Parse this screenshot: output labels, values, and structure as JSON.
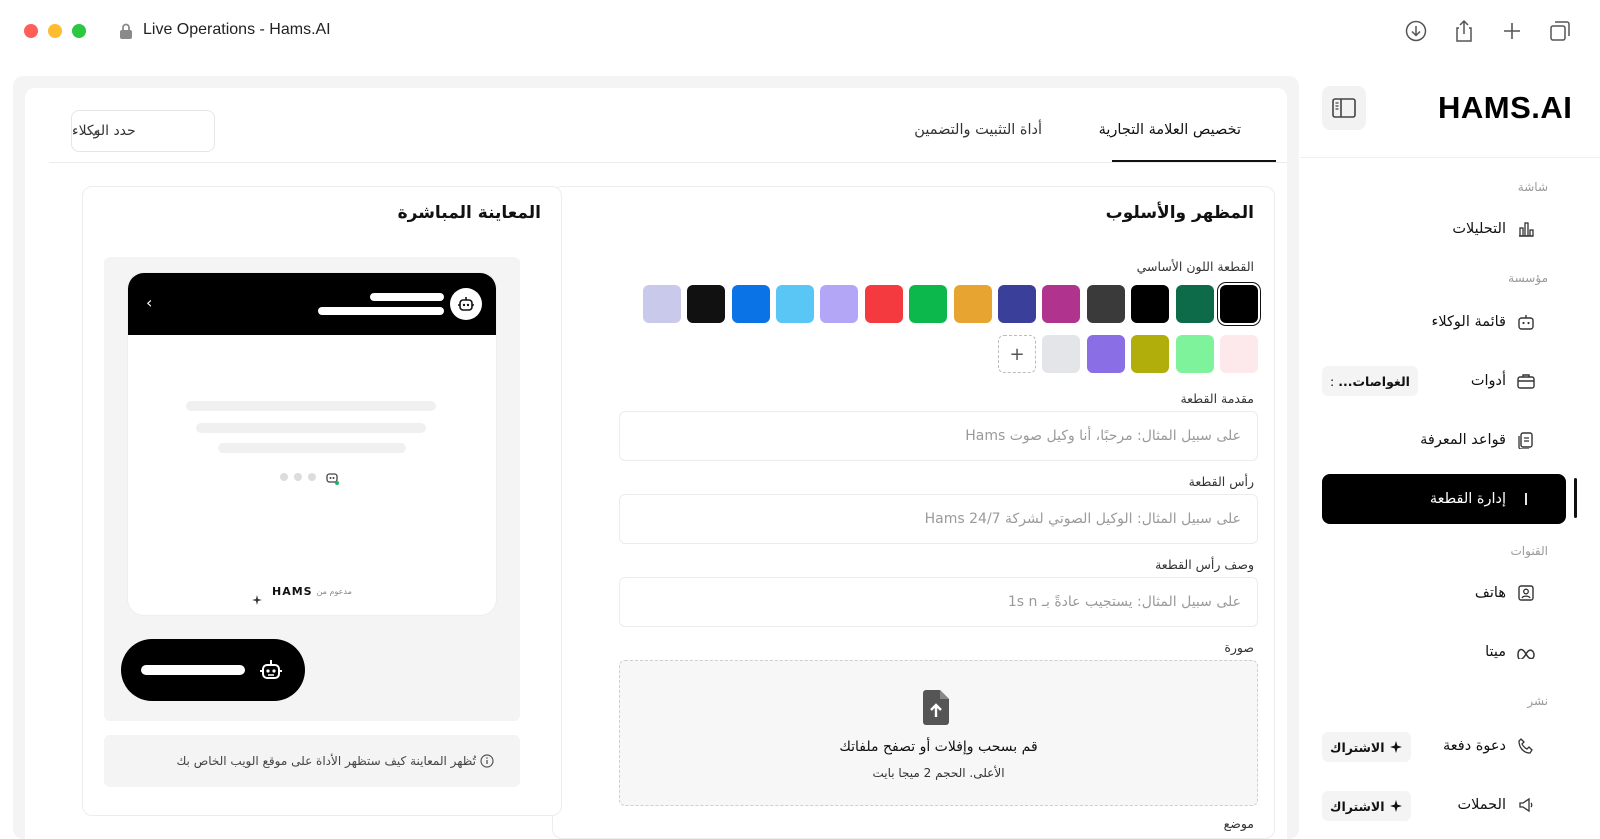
{
  "window": {
    "title": "Live Operations - Hams.AI"
  },
  "toolbar_icons": [
    "download-icon",
    "share-icon",
    "new-tab-icon",
    "tabs-overview-icon"
  ],
  "tabs": [
    {
      "label": "تخصيص العلامة التجارية",
      "active": true
    },
    {
      "label": "أداة التثبيت والتضمين",
      "active": false
    }
  ],
  "agent_select": {
    "label": "حدد الوكلاء"
  },
  "appearance": {
    "title": "المظهر والأسلوب",
    "primary_color_label": "القطعة اللون الأساسي",
    "colors_row1": [
      "#000000",
      "#0d6b4a",
      "#000000",
      "#3a3a3a",
      "#b0348e",
      "#3a3f9a",
      "#e8a430",
      "#0cb84b",
      "#f43a3f",
      "#b3a6f7",
      "#5ac6f6",
      "#0a73e6",
      "#111111",
      "#c9c9ec"
    ],
    "colors_row2": [
      "#fde9ec",
      "#7ff39c",
      "#b1ad0a",
      "#8a6ee6",
      "#e3e5e8"
    ],
    "selected_color": "#000000",
    "intro_label": "مقدمة القطعة",
    "intro_placeholder": "على سبيل المثال: مرحبًا، أنا وكيل صوت Hams",
    "header_label": "رأس القطعة",
    "header_placeholder": "على سبيل المثال: الوكيل الصوتي لشركة Hams 24/7",
    "header_desc_label": "وصف رأس القطعة",
    "header_desc_placeholder": "على سبيل المثال: يستجيب عادةً بـ 1s n",
    "image_label": "صورة",
    "dropzone_main": "قم بسحب وإفلات أو تصفح ملفاتك",
    "dropzone_sub": "الأعلى. الحجم 2 ميجا بايت",
    "position_label": "موضع"
  },
  "preview": {
    "title": "المعاينة المباشرة",
    "powered_by": "مدعوم من",
    "powered_logo": "HAMS",
    "note": "تُظهر المعاينة كيف ستظهر الأداة على موقع الويب الخاص بك"
  },
  "sidebar": {
    "brand": "HAMS.AI",
    "sections": {
      "screen": "شاشة",
      "org": "مؤسسة",
      "channels": "القنوات",
      "publish": "نشر"
    },
    "items": {
      "analytics": "التحليلات",
      "agents": "قائمة الوكلاء",
      "tools": "أدوات",
      "tools_chip": "الغواصات...",
      "knowledge": "قواعد المعرفة",
      "widget": "إدارة القطعة",
      "phone": "هاتف",
      "meta": "ميتا",
      "campaign_invite": "دعوة دفعة",
      "campaigns": "الحملات",
      "subscribe": "الاشتراك"
    }
  }
}
